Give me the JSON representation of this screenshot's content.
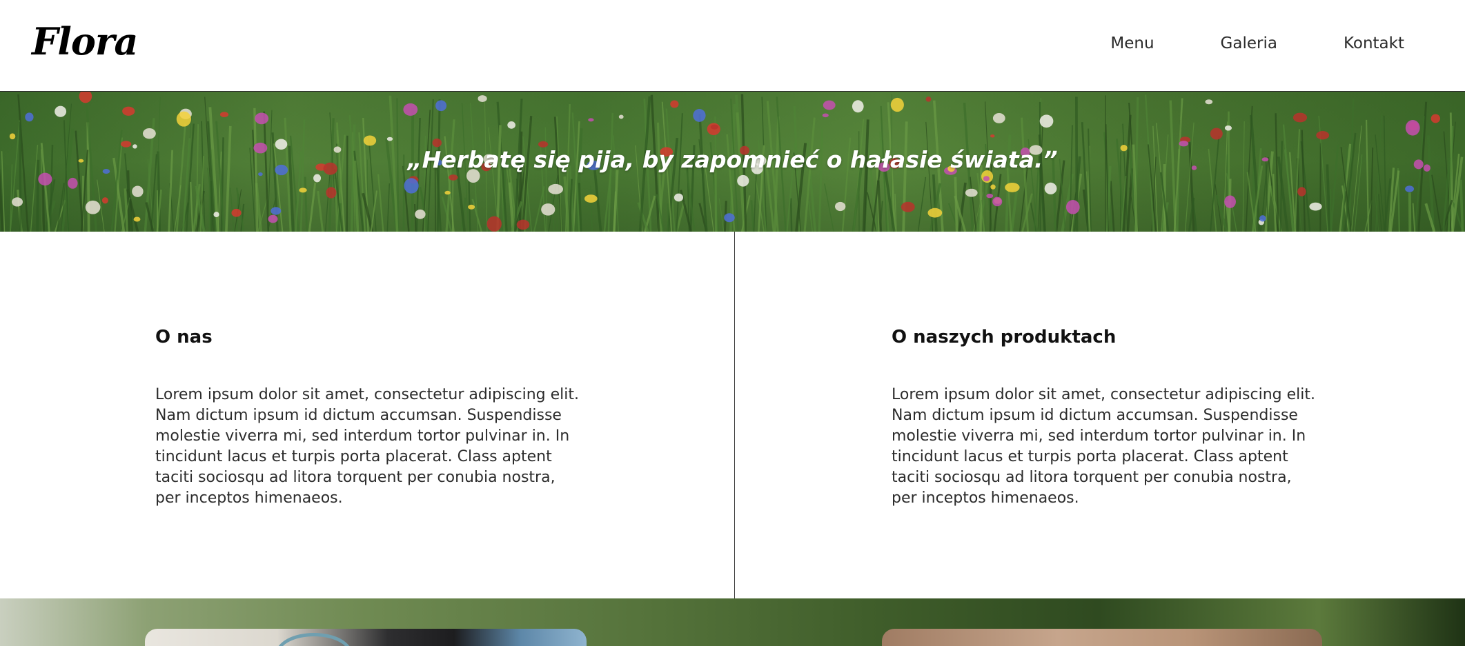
{
  "header": {
    "logo": "Flora",
    "nav": [
      "Menu",
      "Galeria",
      "Kontakt"
    ]
  },
  "hero": {
    "quote": "„Herbatę się pija, by zapomnieć o hałasie świata.”"
  },
  "sections": [
    {
      "title": "O nas",
      "text": "Lorem ipsum dolor sit amet, consectetur adipiscing elit. Nam dictum ipsum id dictum accumsan. Suspendisse molestie viverra mi, sed interdum tortor pulvinar in. In tincidunt lacus et turpis porta placerat. Class aptent taciti sociosqu ad litora torquent per conubia nostra, per inceptos himenaeos."
    },
    {
      "title": "O naszych produktach",
      "text": "Lorem ipsum dolor sit amet, consectetur adipiscing elit. Nam dictum ipsum id dictum accumsan. Suspendisse molestie viverra mi, sed interdum tortor pulvinar in. In tincidunt lacus et turpis porta placerat. Class aptent taciti sociosqu ad litora torquent per conubia nostra, per inceptos himenaeos."
    }
  ],
  "colors": {
    "background": "#ffffff",
    "text": "#1a1a1a",
    "divider": "#3a3a3a",
    "hero_green": "#4a7a33"
  }
}
